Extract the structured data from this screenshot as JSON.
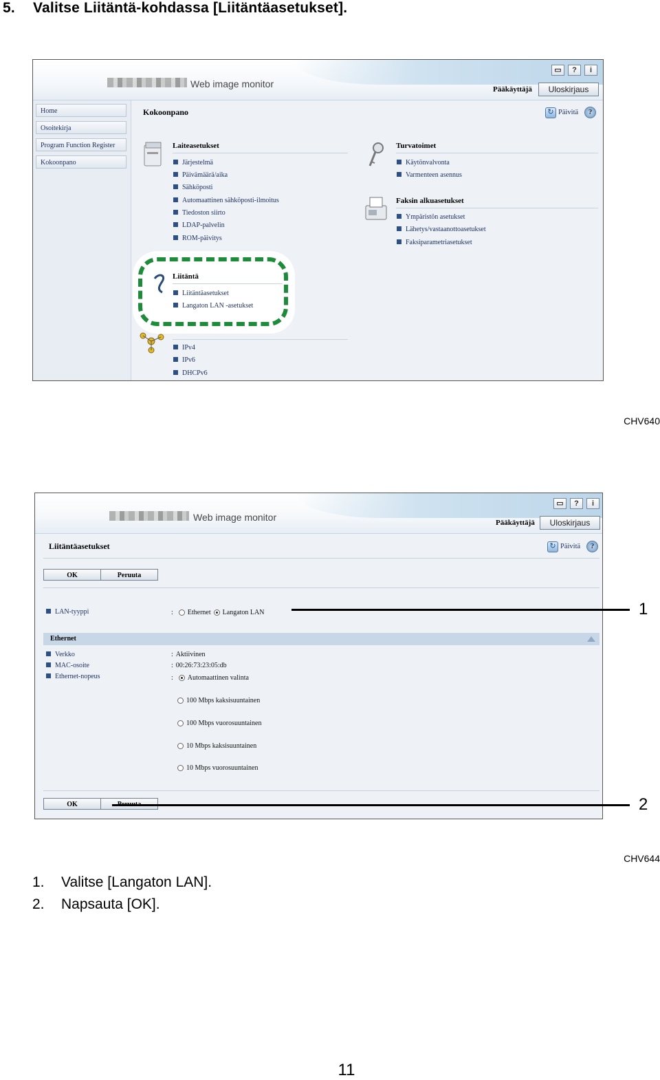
{
  "heading": {
    "number": "5.",
    "text": "Valitse Liitäntä-kohdassa [Liitäntäasetukset]."
  },
  "screenshot1": {
    "app_title": "Web image monitor",
    "user_label": "Pääkäyttäjä",
    "logout_label": "Uloskirjaus",
    "icons": [
      "keyboard-icon",
      "help-icon",
      "info-icon"
    ],
    "nav": [
      "Home",
      "Osoitekirja",
      "Program Function Register",
      "Kokoonpano"
    ],
    "page_title": "Kokoonpano",
    "refresh_label": "Päivitä",
    "sections": {
      "device": {
        "title": "Laiteasetukset",
        "items": [
          "Järjestelmä",
          "Päivämäärä/aika",
          "Sähköposti",
          "Automaattinen sähköposti-ilmoitus",
          "Tiedoston siirto",
          "LDAP-palvelin",
          "ROM-päivitys"
        ]
      },
      "interface": {
        "title": "Liitäntä",
        "items": [
          "Liitäntäasetukset",
          "Langaton LAN -asetukset"
        ]
      },
      "network": {
        "items": [
          "IPv4",
          "IPv6",
          "DHCPv6"
        ]
      },
      "security": {
        "title": "Turvatoimet",
        "items": [
          "Käytönvalvonta",
          "Varmenteen asennus"
        ]
      },
      "fax": {
        "title": "Faksin alkuasetukset",
        "items": [
          "Ympäristön asetukset",
          "Lähetys/vastaanottoasetukset",
          "Faksiparametriasetukset"
        ]
      }
    },
    "figure_id": "CHV640"
  },
  "screenshot2": {
    "app_title": "Web image monitor",
    "user_label": "Pääkäyttäjä",
    "logout_label": "Uloskirjaus",
    "page_title": "Liitäntäasetukset",
    "refresh_label": "Päivitä",
    "ok_label": "OK",
    "cancel_label": "Peruuta",
    "lan_type": {
      "label": "LAN-tyyppi",
      "options": [
        "Ethernet",
        "Langaton LAN"
      ],
      "selected": "Langaton LAN"
    },
    "ethernet_band": "Ethernet",
    "rows": [
      {
        "label": "Verkko",
        "value": "Aktiivinen"
      },
      {
        "label": "MAC-osoite",
        "value": "00:26:73:23:05:db"
      },
      {
        "label": "Ethernet-nopeus",
        "value": ""
      }
    ],
    "speed_options": [
      "Automaattinen valinta",
      "100 Mbps kaksisuuntainen",
      "100 Mbps vuorosuuntainen",
      "10 Mbps kaksisuuntainen",
      "10 Mbps vuorosuuntainen"
    ],
    "speed_selected": "Automaattinen valinta",
    "callouts": [
      "1",
      "2"
    ],
    "figure_id": "CHV644"
  },
  "steps": [
    {
      "number": "1.",
      "text": "Valitse [Langaton LAN]."
    },
    {
      "number": "2.",
      "text": "Napsauta [OK]."
    }
  ],
  "page_number": "11"
}
